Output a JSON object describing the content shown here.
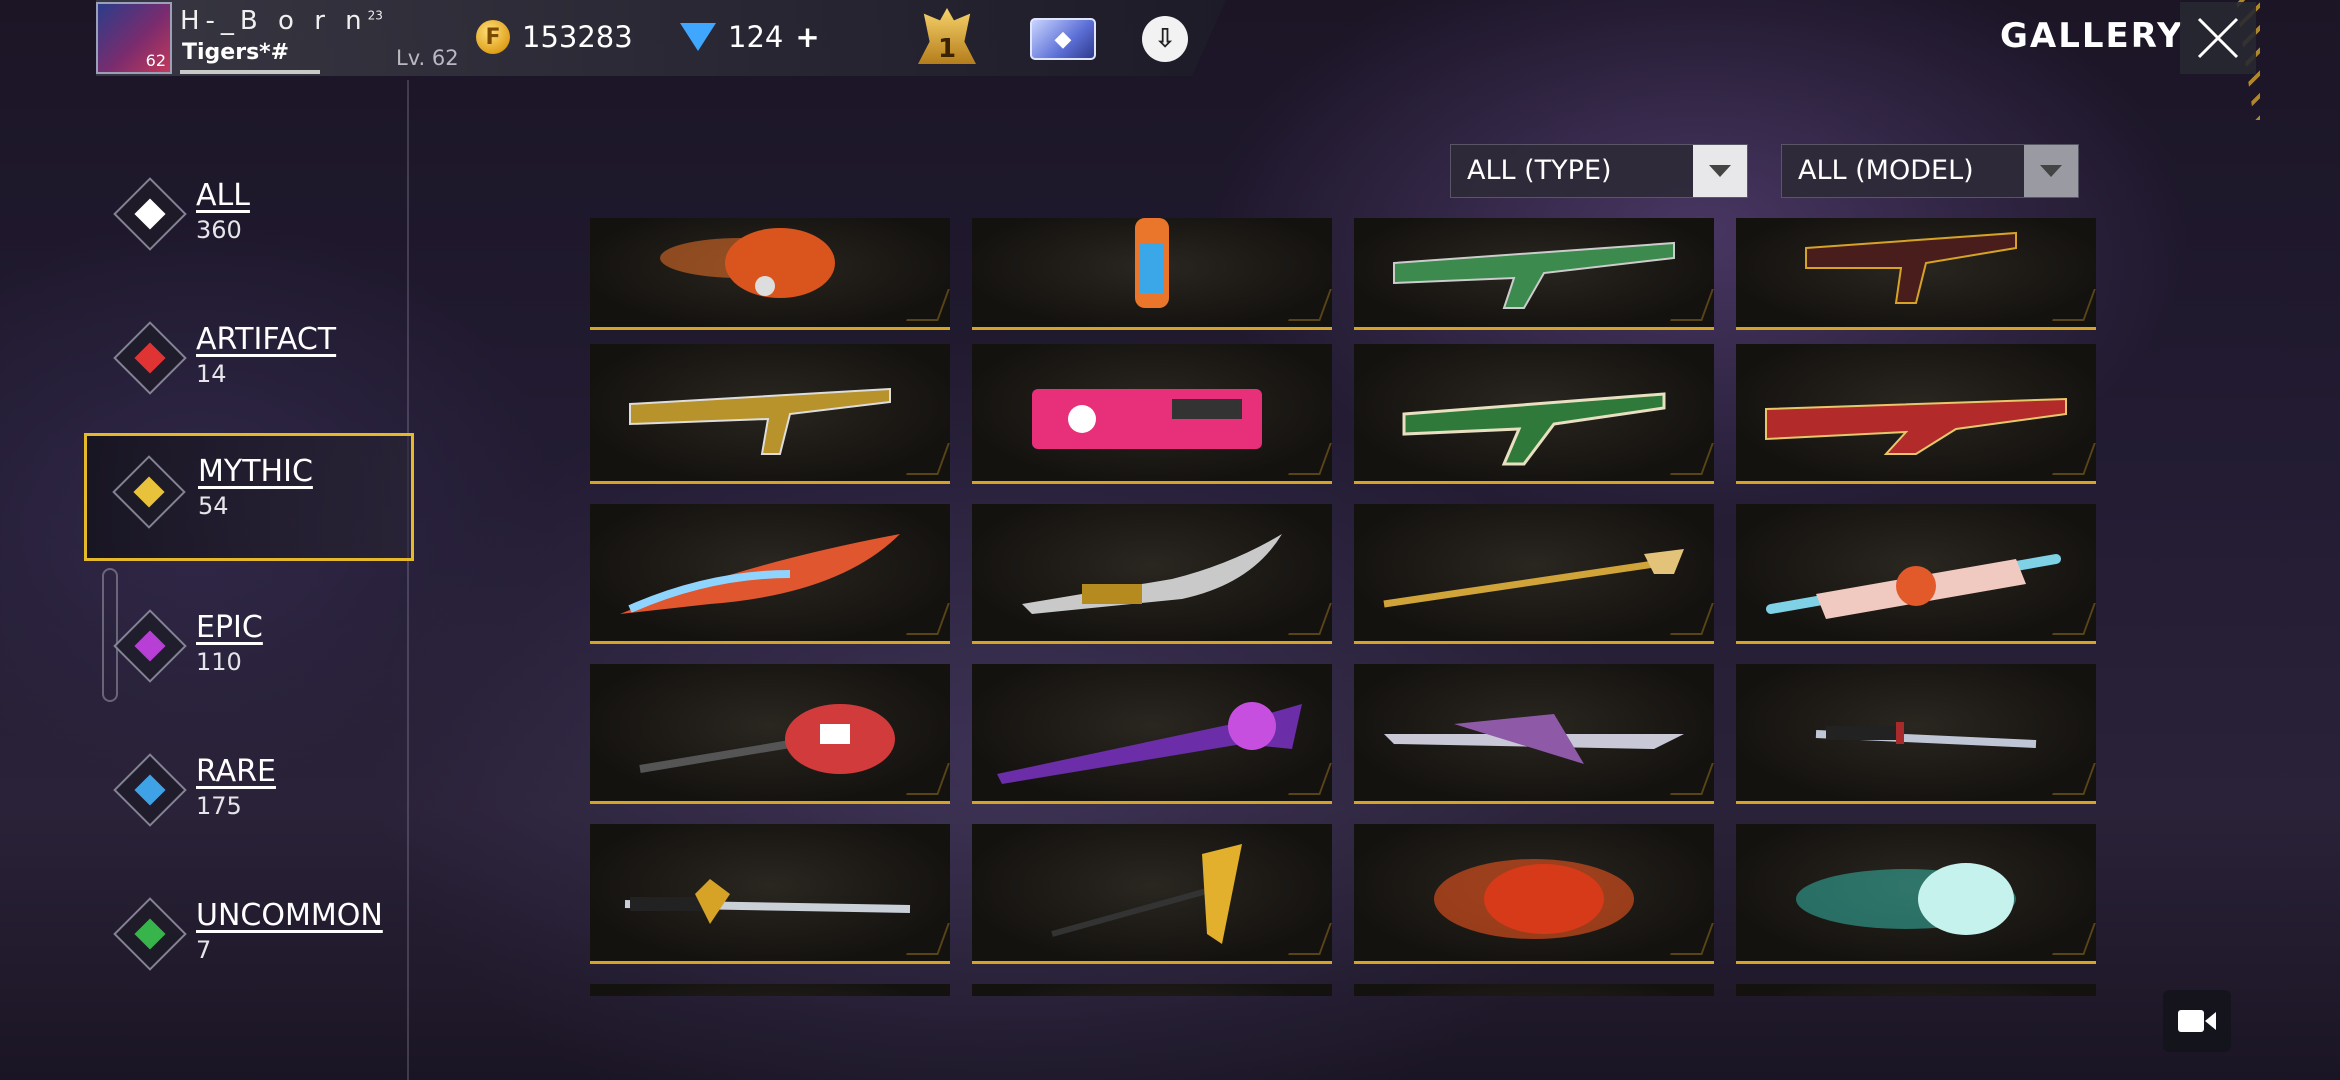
{
  "player": {
    "name": "H-_B o r n",
    "name_sup": "23",
    "guild": "Tigers*#",
    "level": "Lv. 62",
    "avatar_level": "62"
  },
  "currency": {
    "gold": "153283",
    "diamonds": "124",
    "diamonds_plus": "+"
  },
  "badge_rank": "1",
  "header": {
    "title": "GALLERY"
  },
  "categories": [
    {
      "label": "ALL",
      "count": "360",
      "color": "#ffffff"
    },
    {
      "label": "ARTIFACT",
      "count": "14",
      "color": "#e03434"
    },
    {
      "label": "MYTHIC",
      "count": "54",
      "color": "#e8c23a"
    },
    {
      "label": "EPIC",
      "count": "110",
      "color": "#b83fd6"
    },
    {
      "label": "RARE",
      "count": "175",
      "color": "#3fa2e6"
    },
    {
      "label": "UNCOMMON",
      "count": "7",
      "color": "#37b44a"
    }
  ],
  "filters": {
    "type": "ALL (TYPE)",
    "model": "ALL (MODEL)"
  },
  "colors": {
    "accent": "#d6a326",
    "selected_border": "#e5b92a"
  }
}
